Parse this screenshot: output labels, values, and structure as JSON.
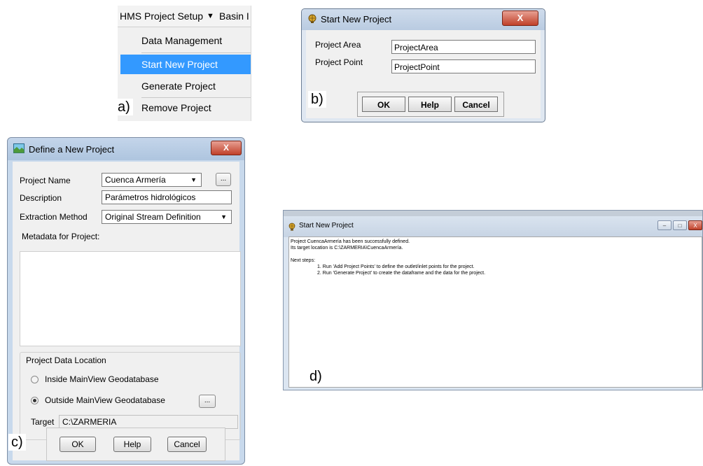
{
  "panels": {
    "a": {
      "label": "a)",
      "menubar": {
        "title": "HMS Project Setup",
        "next_menu": "Basin I"
      },
      "items": [
        {
          "label": "Data Management"
        },
        {
          "label": "Start New Project",
          "selected": true
        },
        {
          "label": "Generate Project"
        },
        {
          "label": "Remove Project"
        }
      ]
    },
    "b": {
      "label": "b)",
      "title": "Start New Project",
      "close": "X",
      "fields": [
        {
          "label": "Project Area",
          "value": "ProjectArea"
        },
        {
          "label": "Project Point",
          "value": "ProjectPoint"
        }
      ],
      "buttons": {
        "ok": "OK",
        "help": "Help",
        "cancel": "Cancel"
      }
    },
    "c": {
      "label": "c)",
      "title": "Define a New Project",
      "close": "X",
      "project_name": {
        "label": "Project Name",
        "value": "Cuenca Armería",
        "browse": "..."
      },
      "description": {
        "label": "Description",
        "value": "Parámetros hidrológicos"
      },
      "extraction_method": {
        "label": "Extraction Method",
        "value": "Original Stream Definition"
      },
      "metadata_label": "Metadata for Project:",
      "location_group": {
        "label": "Project Data Location",
        "inside": "Inside MainView Geodatabase",
        "outside": "Outside MainView Geodatabase",
        "selected": "outside",
        "browse": "...",
        "target_label": "Target",
        "target_value": "C:\\ZARMERIA"
      },
      "buttons": {
        "ok": "OK",
        "help": "Help",
        "cancel": "Cancel"
      }
    },
    "d": {
      "label": "d)",
      "title": "Start New Project",
      "window_buttons": {
        "minimize": "–",
        "maximize": "□",
        "close": "X"
      },
      "lines": [
        "Project CuencaArmería has been successfully defined.",
        "Its target location is C:\\ZARMERIA\\CuencaArmería.",
        "Next steps:",
        "1. Run 'Add Project Points' to define the outlet/inlet points for the project.",
        "2. Run 'Generate Project' to create the dataframe and the data for the project."
      ]
    }
  }
}
